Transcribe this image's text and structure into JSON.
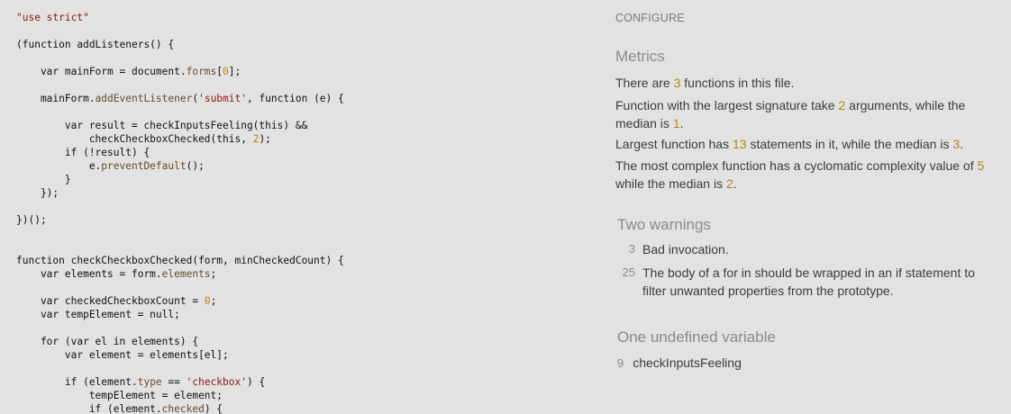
{
  "code": {
    "lines": [
      "\"use strict\"",
      "",
      "(function addListeners() {",
      "",
      "    var mainForm = document.forms[0];",
      "",
      "    mainForm.addEventListener('submit', function (e) {",
      "",
      "        var result = checkInputsFeeling(this) &&",
      "            checkCheckboxChecked(this, 2);",
      "        if (!result) {",
      "            e.preventDefault();",
      "        }",
      "    });",
      "",
      "})();",
      "",
      "",
      "function checkCheckboxChecked(form, minCheckedCount) {",
      "    var elements = form.elements;",
      "",
      "    var checkedCheckboxCount = 0;",
      "    var tempElement = null;",
      "",
      "    for (var el in elements) {",
      "        var element = elements[el];",
      "",
      "        if (element.type == 'checkbox') {",
      "            tempElement = element;",
      "            if (element.checked) {"
    ]
  },
  "panel": {
    "configure_label": "CONFIGURE",
    "metrics_title": "Metrics",
    "metrics": {
      "line1_pre": "There are ",
      "line1_num": "3",
      "line1_post": " functions in this file.",
      "line2_pre": "Function with the largest signature take ",
      "line2_num": "2",
      "line2_mid": " arguments, while the median is ",
      "line2_num2": "1",
      "line2_post": ".",
      "line3_pre": "Largest function has ",
      "line3_num": "13",
      "line3_mid": " statements in it, while the median is ",
      "line3_num2": "3",
      "line3_post": ".",
      "line4_pre": "The most complex function has a cyclomatic complexity value of ",
      "line4_num": "5",
      "line4_mid": " while the median is ",
      "line4_num2": "2",
      "line4_post": "."
    },
    "warnings_title": "Two warnings",
    "warnings": [
      {
        "line": "3",
        "message": "Bad invocation."
      },
      {
        "line": "25",
        "message": "The body of a for in should be wrapped in an if statement to filter unwanted properties from the prototype."
      }
    ],
    "undefined_title": "One undefined variable",
    "undefined": [
      {
        "line": "9",
        "name": "checkInputsFeeling"
      }
    ]
  }
}
